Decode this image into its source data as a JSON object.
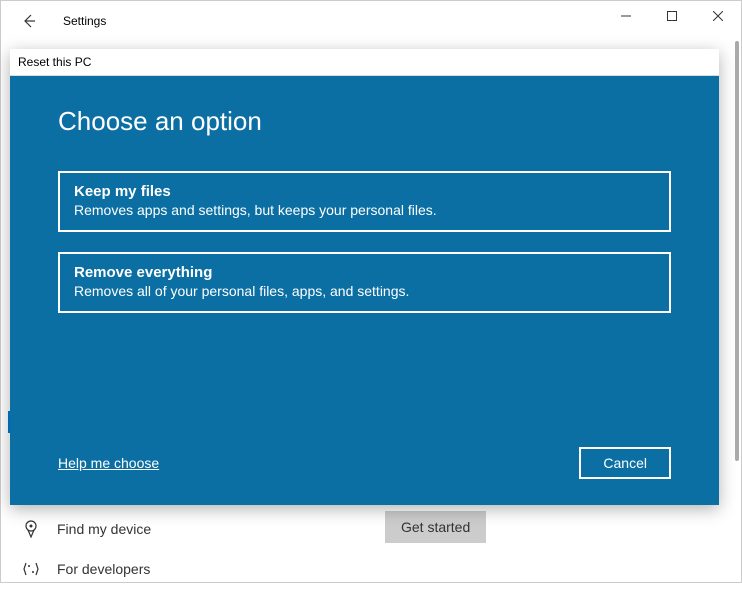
{
  "window": {
    "title": "Settings"
  },
  "dialog": {
    "header": "Reset this PC",
    "title": "Choose an option",
    "option1": {
      "title": "Keep my files",
      "desc": "Removes apps and settings, but keeps your personal files."
    },
    "option2": {
      "title": "Remove everything",
      "desc": "Removes all of your personal files, apps, and settings."
    },
    "help_link": "Help me choose",
    "cancel": "Cancel"
  },
  "sidebar": {
    "find_my_device": "Find my device",
    "for_developers": "For developers"
  },
  "main": {
    "get_started": "Get started"
  }
}
